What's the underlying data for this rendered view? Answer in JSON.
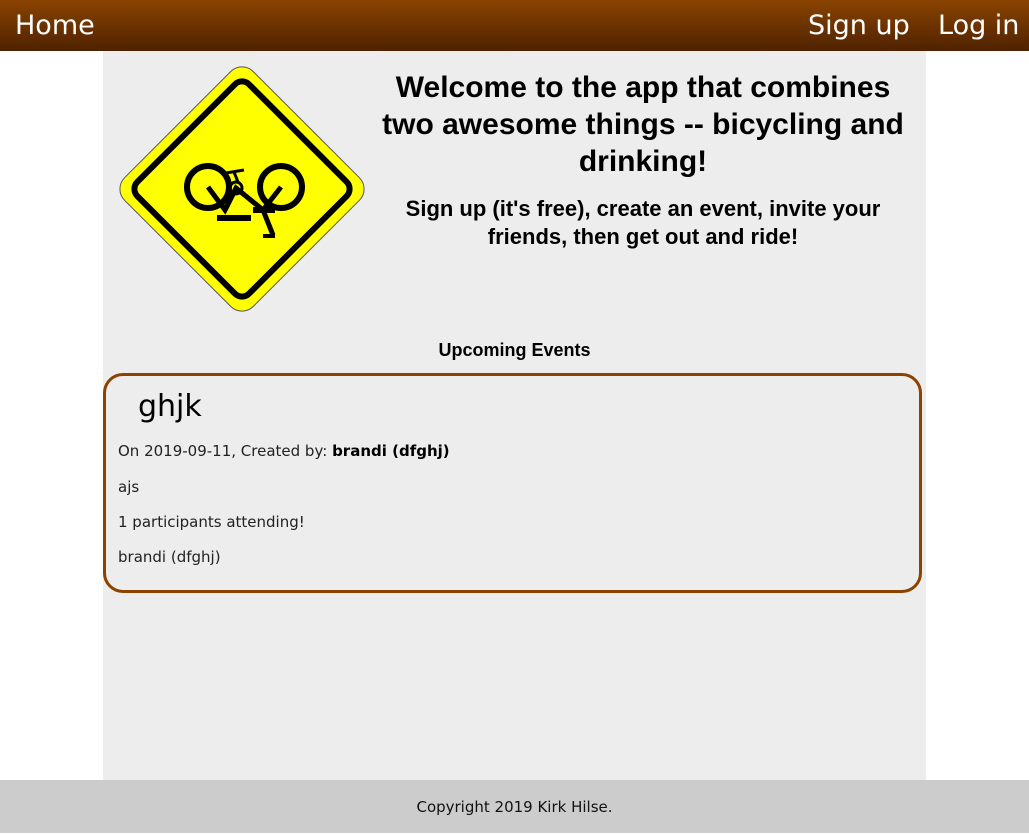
{
  "nav": {
    "home": "Home",
    "signup": "Sign up",
    "login": "Log in"
  },
  "hero": {
    "title": "Welcome to the app that combines two awesome things -- bicycling and drinking!",
    "subtitle": "Sign up (it's free), create an event, invite your friends, then get out and ride!"
  },
  "logo": {
    "icon": "crashed-bicycle-warning-sign"
  },
  "events": {
    "heading": "Upcoming Events",
    "items": [
      {
        "title": "ghjk",
        "date_prefix": "On 2019-09-11, Created by: ",
        "creator": "brandi (dfghj)",
        "description": "ajs",
        "participants": "1 participants attending!",
        "attendee": "brandi (dfghj)"
      }
    ]
  },
  "footer": {
    "copyright": "Copyright 2019 Kirk Hilse."
  },
  "colors": {
    "nav_top": "#8a4300",
    "nav_bottom": "#4f2200",
    "card_border": "#8a4300",
    "content_bg": "#ededed",
    "footer_bg": "#cccccc",
    "sign_yellow": "#ffff00"
  }
}
